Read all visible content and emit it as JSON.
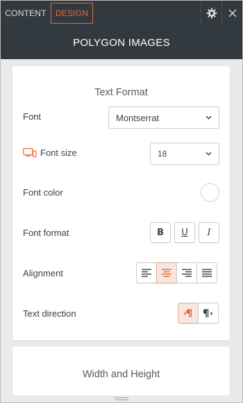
{
  "tabs": {
    "content": "CONTENT",
    "design": "DESIGN"
  },
  "header": {
    "title": "POLYGON IMAGES"
  },
  "text_format": {
    "title": "Text Format",
    "font_label": "Font",
    "font_value": "Montserrat",
    "font_size_label": "Font size",
    "font_size_value": "18",
    "font_color_label": "Font color",
    "font_format_label": "Font format",
    "format_buttons": [
      "B",
      "U",
      "I"
    ],
    "alignment_label": "Alignment",
    "text_direction_label": "Text direction"
  },
  "width_height": {
    "title": "Width and Height"
  },
  "colors": {
    "accent": "#e8663d",
    "header_bg": "#333a3f"
  }
}
